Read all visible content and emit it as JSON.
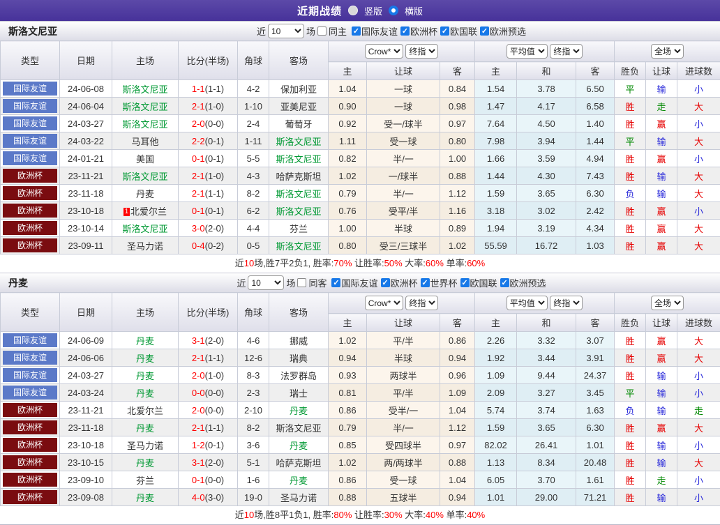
{
  "title_bar": {
    "title": "近期战绩",
    "radio_vertical": "竖版",
    "radio_horizontal": "横版",
    "selected": "横版"
  },
  "colors": {
    "accent_purple": "#4C3697",
    "badge_blue": "#5B79C8",
    "badge_dark_red": "#7A0C10",
    "team_green": "#009933",
    "score_red": "#FF0000",
    "win_red": "#E60000",
    "draw_green": "#008800",
    "lose_blue": "#2626D9",
    "checkbox_blue": "#1778E8"
  },
  "filters": {
    "near_label": "近",
    "near_value": "10",
    "games_label": "场"
  },
  "table_header": {
    "col_type": "类型",
    "col_date": "日期",
    "col_home": "主场",
    "col_score": "比分(半场)",
    "col_corner": "角球",
    "col_away": "客场",
    "odds_source": "Crow*",
    "odds_stage": "终指",
    "avg_source": "平均值",
    "avg_stage": "终指",
    "scope": "全场",
    "sub_odds_home": "主",
    "sub_odds_handicap": "让球",
    "sub_odds_away": "客",
    "sub_avg_home": "主",
    "sub_avg_draw": "和",
    "sub_avg_away": "客",
    "col_result": "胜负",
    "col_handicap_result": "让球",
    "col_goals": "进球数"
  },
  "sections": [
    {
      "team": "斯洛文尼亚",
      "same_venue_label": "同主",
      "competitions": [
        "国际友谊",
        "欧洲杯",
        "欧国联",
        "欧洲预选"
      ],
      "rows": [
        {
          "type": "国际友谊",
          "tc": "blue",
          "date": "24-06-08",
          "home": "斯洛文尼亚",
          "hg": true,
          "rc": null,
          "ft": "1-1",
          "ht": "(1-1)",
          "corner": "4-2",
          "away": "保加利亚",
          "ag": false,
          "ch": "1.04",
          "hcap": "一球",
          "ca": "0.84",
          "ah": "1.54",
          "ad": "3.78",
          "aa": "6.50",
          "res": "平",
          "resC": "g",
          "hres": "输",
          "hresC": "b",
          "gres": "小",
          "gresC": "b"
        },
        {
          "type": "国际友谊",
          "tc": "blue",
          "date": "24-06-04",
          "home": "斯洛文尼亚",
          "hg": true,
          "rc": null,
          "ft": "2-1",
          "ht": "(1-0)",
          "corner": "1-10",
          "away": "亚美尼亚",
          "ag": false,
          "ch": "0.90",
          "hcap": "一球",
          "ca": "0.98",
          "ah": "1.47",
          "ad": "4.17",
          "aa": "6.58",
          "res": "胜",
          "resC": "r",
          "hres": "走",
          "hresC": "g",
          "gres": "大",
          "gresC": "r"
        },
        {
          "type": "国际友谊",
          "tc": "blue",
          "date": "24-03-27",
          "home": "斯洛文尼亚",
          "hg": true,
          "rc": null,
          "ft": "2-0",
          "ht": "(0-0)",
          "corner": "2-4",
          "away": "葡萄牙",
          "ag": false,
          "ch": "0.92",
          "hcap": "受一/球半",
          "ca": "0.97",
          "ah": "7.64",
          "ad": "4.50",
          "aa": "1.40",
          "res": "胜",
          "resC": "r",
          "hres": "赢",
          "hresC": "r",
          "gres": "小",
          "gresC": "b"
        },
        {
          "type": "国际友谊",
          "tc": "blue",
          "date": "24-03-22",
          "home": "马耳他",
          "hg": false,
          "rc": null,
          "ft": "2-2",
          "ht": "(0-1)",
          "corner": "1-11",
          "away": "斯洛文尼亚",
          "ag": true,
          "ch": "1.11",
          "hcap": "受一球",
          "ca": "0.80",
          "ah": "7.98",
          "ad": "3.94",
          "aa": "1.44",
          "res": "平",
          "resC": "g",
          "hres": "输",
          "hresC": "b",
          "gres": "大",
          "gresC": "r"
        },
        {
          "type": "国际友谊",
          "tc": "blue",
          "date": "24-01-21",
          "home": "美国",
          "hg": false,
          "rc": null,
          "ft": "0-1",
          "ht": "(0-1)",
          "corner": "5-5",
          "away": "斯洛文尼亚",
          "ag": true,
          "ch": "0.82",
          "hcap": "半/一",
          "ca": "1.00",
          "ah": "1.66",
          "ad": "3.59",
          "aa": "4.94",
          "res": "胜",
          "resC": "r",
          "hres": "赢",
          "hresC": "r",
          "gres": "小",
          "gresC": "b"
        },
        {
          "type": "欧洲杯",
          "tc": "red",
          "date": "23-11-21",
          "home": "斯洛文尼亚",
          "hg": true,
          "rc": null,
          "ft": "2-1",
          "ht": "(1-0)",
          "corner": "4-3",
          "away": "哈萨克斯坦",
          "ag": false,
          "ch": "1.02",
          "hcap": "一/球半",
          "ca": "0.88",
          "ah": "1.44",
          "ad": "4.30",
          "aa": "7.43",
          "res": "胜",
          "resC": "r",
          "hres": "输",
          "hresC": "b",
          "gres": "大",
          "gresC": "r"
        },
        {
          "type": "欧洲杯",
          "tc": "red",
          "date": "23-11-18",
          "home": "丹麦",
          "hg": false,
          "rc": null,
          "ft": "2-1",
          "ht": "(1-1)",
          "corner": "8-2",
          "away": "斯洛文尼亚",
          "ag": true,
          "ch": "0.79",
          "hcap": "半/一",
          "ca": "1.12",
          "ah": "1.59",
          "ad": "3.65",
          "aa": "6.30",
          "res": "负",
          "resC": "b",
          "hres": "输",
          "hresC": "b",
          "gres": "大",
          "gresC": "r"
        },
        {
          "type": "欧洲杯",
          "tc": "red",
          "date": "23-10-18",
          "home": "北爱尔兰",
          "hg": false,
          "rc": "1",
          "ft": "0-1",
          "ht": "(0-1)",
          "corner": "6-2",
          "away": "斯洛文尼亚",
          "ag": true,
          "ch": "0.76",
          "hcap": "受平/半",
          "ca": "1.16",
          "ah": "3.18",
          "ad": "3.02",
          "aa": "2.42",
          "res": "胜",
          "resC": "r",
          "hres": "赢",
          "hresC": "r",
          "gres": "小",
          "gresC": "b"
        },
        {
          "type": "欧洲杯",
          "tc": "red",
          "date": "23-10-14",
          "home": "斯洛文尼亚",
          "hg": true,
          "rc": null,
          "ft": "3-0",
          "ht": "(2-0)",
          "corner": "4-4",
          "away": "芬兰",
          "ag": false,
          "ch": "1.00",
          "hcap": "半球",
          "ca": "0.89",
          "ah": "1.94",
          "ad": "3.19",
          "aa": "4.34",
          "res": "胜",
          "resC": "r",
          "hres": "赢",
          "hresC": "r",
          "gres": "大",
          "gresC": "r"
        },
        {
          "type": "欧洲杯",
          "tc": "red",
          "date": "23-09-11",
          "home": "圣马力诺",
          "hg": false,
          "rc": null,
          "ft": "0-4",
          "ht": "(0-2)",
          "corner": "0-5",
          "away": "斯洛文尼亚",
          "ag": true,
          "ch": "0.80",
          "hcap": "受三/三球半",
          "ca": "1.02",
          "ah": "55.59",
          "ad": "16.72",
          "aa": "1.03",
          "res": "胜",
          "resC": "r",
          "hres": "赢",
          "hresC": "r",
          "gres": "大",
          "gresC": "r"
        }
      ],
      "summary": [
        {
          "t": "近",
          "r": false
        },
        {
          "t": "10",
          "r": true
        },
        {
          "t": "场,胜7平2负1, 胜率:",
          "r": false
        },
        {
          "t": "70%",
          "r": true
        },
        {
          "t": " 让胜率:",
          "r": false
        },
        {
          "t": "50%",
          "r": true
        },
        {
          "t": " 大率:",
          "r": false
        },
        {
          "t": "60%",
          "r": true
        },
        {
          "t": " 单率:",
          "r": false
        },
        {
          "t": "60%",
          "r": true
        }
      ]
    },
    {
      "team": "丹麦",
      "same_venue_label": "同客",
      "competitions": [
        "国际友谊",
        "欧洲杯",
        "世界杯",
        "欧国联",
        "欧洲预选"
      ],
      "rows": [
        {
          "type": "国际友谊",
          "tc": "blue",
          "date": "24-06-09",
          "home": "丹麦",
          "hg": true,
          "rc": null,
          "ft": "3-1",
          "ht": "(2-0)",
          "corner": "4-6",
          "away": "挪威",
          "ag": false,
          "ch": "1.02",
          "hcap": "平/半",
          "ca": "0.86",
          "ah": "2.26",
          "ad": "3.32",
          "aa": "3.07",
          "res": "胜",
          "resC": "r",
          "hres": "赢",
          "hresC": "r",
          "gres": "大",
          "gresC": "r"
        },
        {
          "type": "国际友谊",
          "tc": "blue",
          "date": "24-06-06",
          "home": "丹麦",
          "hg": true,
          "rc": null,
          "ft": "2-1",
          "ht": "(1-1)",
          "corner": "12-6",
          "away": "瑞典",
          "ag": false,
          "ch": "0.94",
          "hcap": "半球",
          "ca": "0.94",
          "ah": "1.92",
          "ad": "3.44",
          "aa": "3.91",
          "res": "胜",
          "resC": "r",
          "hres": "赢",
          "hresC": "r",
          "gres": "大",
          "gresC": "r"
        },
        {
          "type": "国际友谊",
          "tc": "blue",
          "date": "24-03-27",
          "home": "丹麦",
          "hg": true,
          "rc": null,
          "ft": "2-0",
          "ht": "(1-0)",
          "corner": "8-3",
          "away": "法罗群岛",
          "ag": false,
          "ch": "0.93",
          "hcap": "两球半",
          "ca": "0.96",
          "ah": "1.09",
          "ad": "9.44",
          "aa": "24.37",
          "res": "胜",
          "resC": "r",
          "hres": "输",
          "hresC": "b",
          "gres": "小",
          "gresC": "b"
        },
        {
          "type": "国际友谊",
          "tc": "blue",
          "date": "24-03-24",
          "home": "丹麦",
          "hg": true,
          "rc": null,
          "ft": "0-0",
          "ht": "(0-0)",
          "corner": "2-3",
          "away": "瑞士",
          "ag": false,
          "ch": "0.81",
          "hcap": "平/半",
          "ca": "1.09",
          "ah": "2.09",
          "ad": "3.27",
          "aa": "3.45",
          "res": "平",
          "resC": "g",
          "hres": "输",
          "hresC": "b",
          "gres": "小",
          "gresC": "b"
        },
        {
          "type": "欧洲杯",
          "tc": "red",
          "date": "23-11-21",
          "home": "北爱尔兰",
          "hg": false,
          "rc": null,
          "ft": "2-0",
          "ht": "(0-0)",
          "corner": "2-10",
          "away": "丹麦",
          "ag": true,
          "ch": "0.86",
          "hcap": "受半/一",
          "ca": "1.04",
          "ah": "5.74",
          "ad": "3.74",
          "aa": "1.63",
          "res": "负",
          "resC": "b",
          "hres": "输",
          "hresC": "b",
          "gres": "走",
          "gresC": "g"
        },
        {
          "type": "欧洲杯",
          "tc": "red",
          "date": "23-11-18",
          "home": "丹麦",
          "hg": true,
          "rc": null,
          "ft": "2-1",
          "ht": "(1-1)",
          "corner": "8-2",
          "away": "斯洛文尼亚",
          "ag": false,
          "ch": "0.79",
          "hcap": "半/一",
          "ca": "1.12",
          "ah": "1.59",
          "ad": "3.65",
          "aa": "6.30",
          "res": "胜",
          "resC": "r",
          "hres": "赢",
          "hresC": "r",
          "gres": "大",
          "gresC": "r"
        },
        {
          "type": "欧洲杯",
          "tc": "red",
          "date": "23-10-18",
          "home": "圣马力诺",
          "hg": false,
          "rc": null,
          "ft": "1-2",
          "ht": "(0-1)",
          "corner": "3-6",
          "away": "丹麦",
          "ag": true,
          "ch": "0.85",
          "hcap": "受四球半",
          "ca": "0.97",
          "ah": "82.02",
          "ad": "26.41",
          "aa": "1.01",
          "res": "胜",
          "resC": "r",
          "hres": "输",
          "hresC": "b",
          "gres": "小",
          "gresC": "b"
        },
        {
          "type": "欧洲杯",
          "tc": "red",
          "date": "23-10-15",
          "home": "丹麦",
          "hg": true,
          "rc": null,
          "ft": "3-1",
          "ht": "(2-0)",
          "corner": "5-1",
          "away": "哈萨克斯坦",
          "ag": false,
          "ch": "1.02",
          "hcap": "两/两球半",
          "ca": "0.88",
          "ah": "1.13",
          "ad": "8.34",
          "aa": "20.48",
          "res": "胜",
          "resC": "r",
          "hres": "输",
          "hresC": "b",
          "gres": "大",
          "gresC": "r"
        },
        {
          "type": "欧洲杯",
          "tc": "red",
          "date": "23-09-10",
          "home": "芬兰",
          "hg": false,
          "rc": null,
          "ft": "0-1",
          "ht": "(0-0)",
          "corner": "1-6",
          "away": "丹麦",
          "ag": true,
          "ch": "0.86",
          "hcap": "受一球",
          "ca": "1.04",
          "ah": "6.05",
          "ad": "3.70",
          "aa": "1.61",
          "res": "胜",
          "resC": "r",
          "hres": "走",
          "hresC": "g",
          "gres": "小",
          "gresC": "b"
        },
        {
          "type": "欧洲杯",
          "tc": "red",
          "date": "23-09-08",
          "home": "丹麦",
          "hg": true,
          "rc": null,
          "ft": "4-0",
          "ht": "(3-0)",
          "corner": "19-0",
          "away": "圣马力诺",
          "ag": false,
          "ch": "0.88",
          "hcap": "五球半",
          "ca": "0.94",
          "ah": "1.01",
          "ad": "29.00",
          "aa": "71.21",
          "res": "胜",
          "resC": "r",
          "hres": "输",
          "hresC": "b",
          "gres": "小",
          "gresC": "b"
        }
      ],
      "summary": [
        {
          "t": "近",
          "r": false
        },
        {
          "t": "10",
          "r": true
        },
        {
          "t": "场,胜8平1负1, 胜率:",
          "r": false
        },
        {
          "t": "80%",
          "r": true
        },
        {
          "t": " 让胜率:",
          "r": false
        },
        {
          "t": "30%",
          "r": true
        },
        {
          "t": " 大率:",
          "r": false
        },
        {
          "t": "40%",
          "r": true
        },
        {
          "t": " 单率:",
          "r": false
        },
        {
          "t": "40%",
          "r": true
        }
      ]
    }
  ]
}
